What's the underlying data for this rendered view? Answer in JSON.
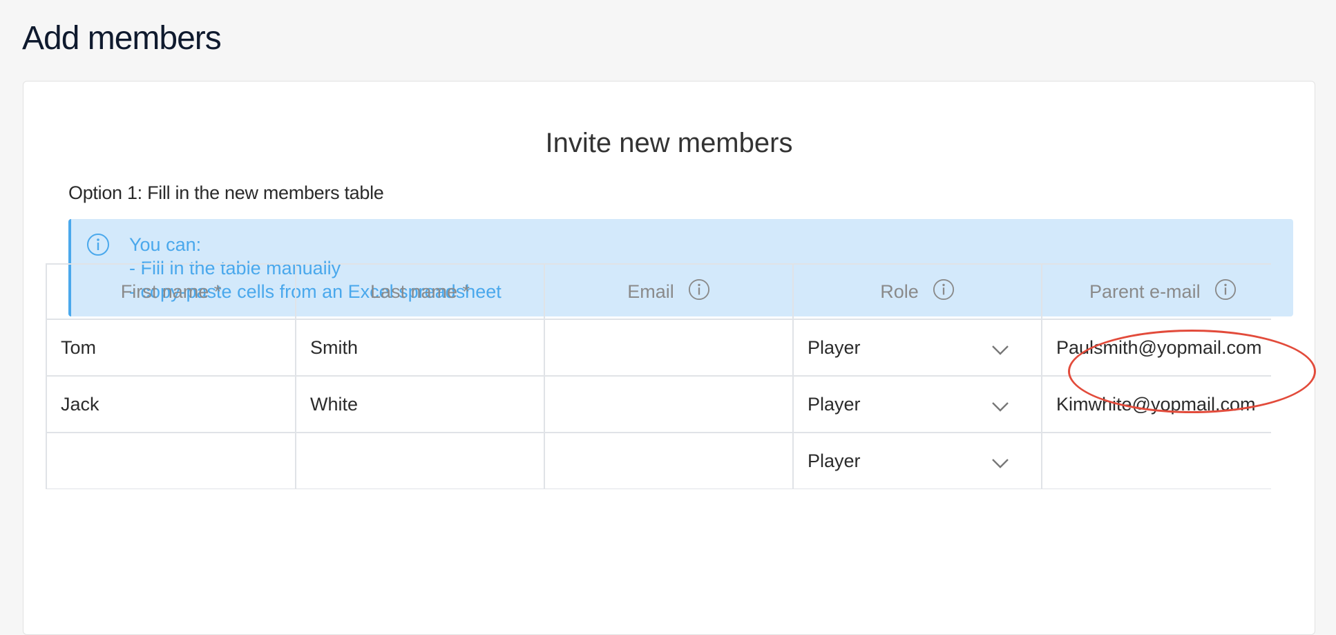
{
  "page": {
    "title": "Add members"
  },
  "card": {
    "title": "Invite new members",
    "option_title": "Option 1: Fill in the new members table",
    "info": {
      "icon": "info-icon",
      "lines": [
        "You can:",
        "- Fill in the table manually",
        "- copy-paste cells from an Excel spreadsheet"
      ]
    }
  },
  "table": {
    "headers": [
      "First name *",
      "Last name *",
      "Email",
      "Role",
      "Parent e-mail"
    ],
    "rows": [
      {
        "first": "Tom",
        "last": "Smith",
        "email": "",
        "role": "Player",
        "parent_email": "Paulsmith@yopmail.com"
      },
      {
        "first": "Jack",
        "last": "White",
        "email": "",
        "role": "Player",
        "parent_email": "Kimwhite@yopmail.com"
      },
      {
        "first": "",
        "last": "",
        "email": "",
        "role": "Player",
        "parent_email": ""
      }
    ]
  },
  "colors": {
    "info_bg": "#d3e9fb",
    "info_text": "#4aa8ec",
    "highlight": "#e24b3b"
  }
}
